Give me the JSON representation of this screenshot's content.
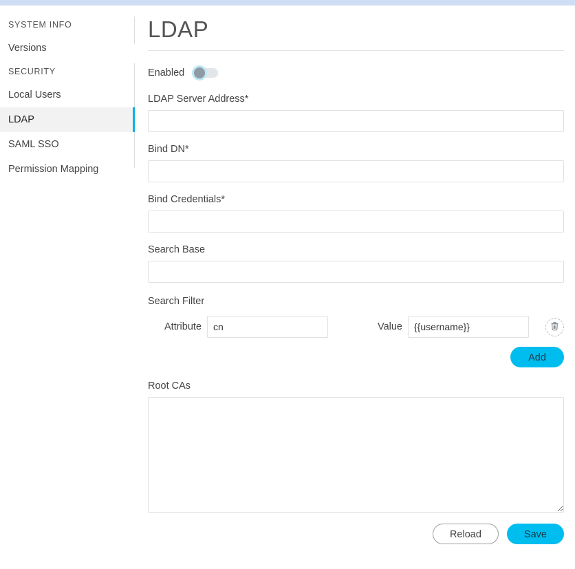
{
  "theme": {
    "accent": "#00bdef",
    "active_marker": "#00b3e3",
    "top_bar": "#cfdef4",
    "active_row_bg": "#f2f2f2"
  },
  "sidebar": {
    "groups": [
      {
        "title": "SYSTEM INFO",
        "items": [
          {
            "label": "Versions",
            "active": false
          }
        ]
      },
      {
        "title": "SECURITY",
        "items": [
          {
            "label": "Local Users",
            "active": false
          },
          {
            "label": "LDAP",
            "active": true
          },
          {
            "label": "SAML SSO",
            "active": false
          },
          {
            "label": "Permission Mapping",
            "active": false
          }
        ]
      }
    ]
  },
  "page": {
    "title": "LDAP"
  },
  "form": {
    "enabled": {
      "label": "Enabled",
      "state": "off"
    },
    "server_address": {
      "label": "LDAP Server Address*",
      "value": "",
      "placeholder": ""
    },
    "bind_dn": {
      "label": "Bind DN*",
      "value": "",
      "placeholder": ""
    },
    "bind_credentials": {
      "label": "Bind Credentials*",
      "value": "",
      "placeholder": ""
    },
    "search_base": {
      "label": "Search Base",
      "value": "",
      "placeholder": ""
    },
    "search_filter": {
      "label": "Search Filter",
      "attribute_label": "Attribute",
      "attribute_value": "cn",
      "value_label": "Value",
      "value_value": "{{username}}",
      "delete_icon": "trash-icon",
      "add_label": "Add"
    },
    "root_cas": {
      "label": "Root CAs",
      "value": "",
      "placeholder": ""
    }
  },
  "footer": {
    "reload_label": "Reload",
    "save_label": "Save"
  }
}
